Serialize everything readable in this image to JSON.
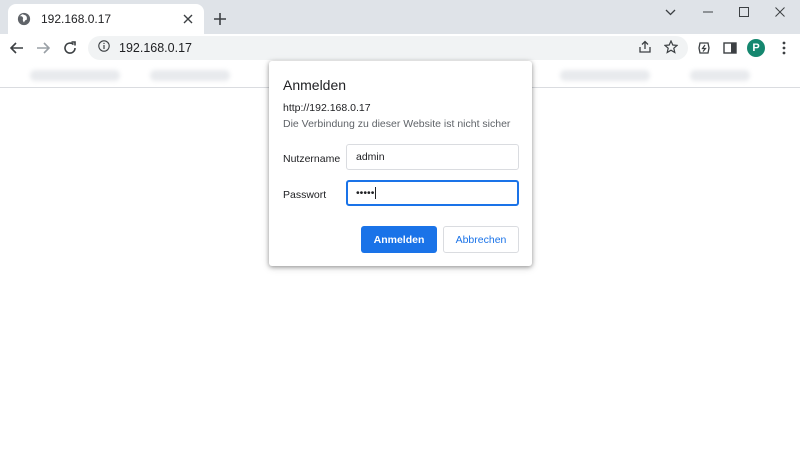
{
  "browser": {
    "tab": {
      "title": "192.168.0.17",
      "favicon": "globe-icon"
    },
    "address": {
      "url": "192.168.0.17",
      "security_icon": "info-icon"
    },
    "profile_initial": "P",
    "accent": "#1a73e8",
    "avatar_color": "#15876f"
  },
  "dialog": {
    "title": "Anmelden",
    "origin": "http://192.168.0.17",
    "warning": "Die Verbindung zu dieser Website ist nicht sicher",
    "username": {
      "label": "Nutzername",
      "value": "admin"
    },
    "password": {
      "label": "Passwort",
      "value": "•••••"
    },
    "submit_label": "Anmelden",
    "cancel_label": "Abbrechen"
  }
}
